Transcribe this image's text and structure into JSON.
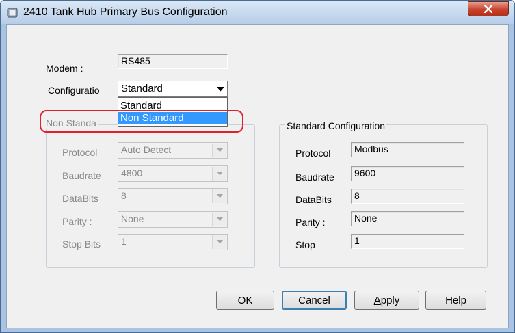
{
  "window": {
    "title": "2410 Tank Hub Primary Bus Configuration"
  },
  "modem": {
    "label": "Modem :",
    "value": "RS485"
  },
  "configuration": {
    "label": "Configuratio",
    "selected": "Standard",
    "options": [
      "Standard",
      "Non Standard"
    ],
    "highlighted_option": "Non Standard"
  },
  "non_standard": {
    "title": "Non Standa",
    "fields": [
      {
        "label": "Protocol",
        "value": "Auto Detect"
      },
      {
        "label": "Baudrate",
        "value": "4800"
      },
      {
        "label": "DataBits",
        "value": "8"
      },
      {
        "label": "Parity :",
        "value": "None"
      },
      {
        "label": "Stop Bits",
        "value": "1"
      }
    ]
  },
  "standard": {
    "title": "Standard Configuration",
    "fields": [
      {
        "label": "Protocol",
        "value": "Modbus"
      },
      {
        "label": "Baudrate",
        "value": "9600"
      },
      {
        "label": "DataBits",
        "value": "8"
      },
      {
        "label": "Parity :",
        "value": "None"
      },
      {
        "label": "Stop",
        "value": "1"
      }
    ]
  },
  "buttons": {
    "ok": "OK",
    "cancel": "Cancel",
    "apply_mnemonic": "A",
    "apply_rest": "pply",
    "help": "Help"
  },
  "colors": {
    "selection": "#3399ff",
    "annotation": "#e0202a",
    "close_button": "#c7412b"
  }
}
